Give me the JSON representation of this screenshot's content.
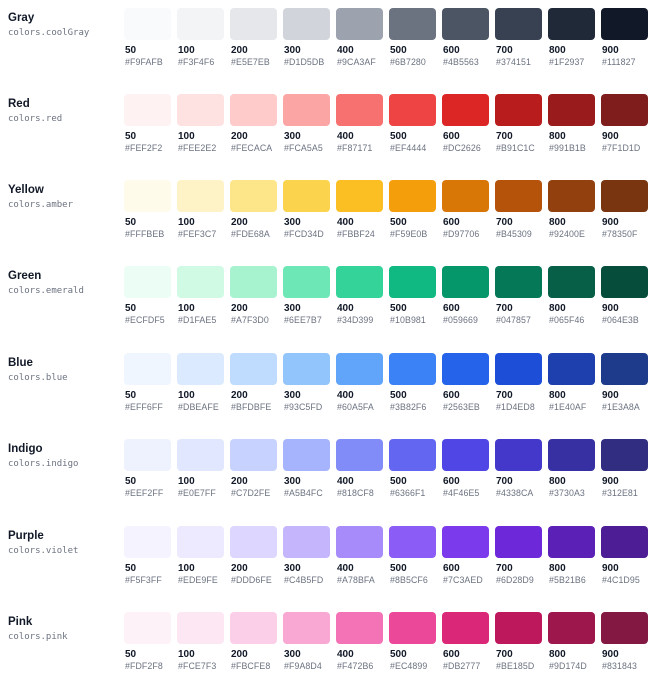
{
  "palettes": [
    {
      "name": "Gray",
      "key": "colors.coolGray",
      "shades": [
        {
          "shade": "50",
          "hex": "#F9FAFB"
        },
        {
          "shade": "100",
          "hex": "#F3F4F6"
        },
        {
          "shade": "200",
          "hex": "#E5E7EB"
        },
        {
          "shade": "300",
          "hex": "#D1D5DB"
        },
        {
          "shade": "400",
          "hex": "#9CA3AF"
        },
        {
          "shade": "500",
          "hex": "#6B7280"
        },
        {
          "shade": "600",
          "hex": "#4B5563"
        },
        {
          "shade": "700",
          "hex": "#374151"
        },
        {
          "shade": "800",
          "hex": "#1F2937"
        },
        {
          "shade": "900",
          "hex": "#111827"
        }
      ]
    },
    {
      "name": "Red",
      "key": "colors.red",
      "shades": [
        {
          "shade": "50",
          "hex": "#FEF2F2"
        },
        {
          "shade": "100",
          "hex": "#FEE2E2"
        },
        {
          "shade": "200",
          "hex": "#FECACA"
        },
        {
          "shade": "300",
          "hex": "#FCA5A5"
        },
        {
          "shade": "400",
          "hex": "#F87171"
        },
        {
          "shade": "500",
          "hex": "#EF4444"
        },
        {
          "shade": "600",
          "hex": "#DC2626"
        },
        {
          "shade": "700",
          "hex": "#B91C1C"
        },
        {
          "shade": "800",
          "hex": "#991B1B"
        },
        {
          "shade": "900",
          "hex": "#7F1D1D"
        }
      ]
    },
    {
      "name": "Yellow",
      "key": "colors.amber",
      "shades": [
        {
          "shade": "50",
          "hex": "#FFFBEB"
        },
        {
          "shade": "100",
          "hex": "#FEF3C7"
        },
        {
          "shade": "200",
          "hex": "#FDE68A"
        },
        {
          "shade": "300",
          "hex": "#FCD34D"
        },
        {
          "shade": "400",
          "hex": "#FBBF24"
        },
        {
          "shade": "500",
          "hex": "#F59E0B"
        },
        {
          "shade": "600",
          "hex": "#D97706"
        },
        {
          "shade": "700",
          "hex": "#B45309"
        },
        {
          "shade": "800",
          "hex": "#92400E"
        },
        {
          "shade": "900",
          "hex": "#78350F"
        }
      ]
    },
    {
      "name": "Green",
      "key": "colors.emerald",
      "shades": [
        {
          "shade": "50",
          "hex": "#ECFDF5"
        },
        {
          "shade": "100",
          "hex": "#D1FAE5"
        },
        {
          "shade": "200",
          "hex": "#A7F3D0"
        },
        {
          "shade": "300",
          "hex": "#6EE7B7"
        },
        {
          "shade": "400",
          "hex": "#34D399"
        },
        {
          "shade": "500",
          "hex": "#10B981"
        },
        {
          "shade": "600",
          "hex": "#059669"
        },
        {
          "shade": "700",
          "hex": "#047857"
        },
        {
          "shade": "800",
          "hex": "#065F46"
        },
        {
          "shade": "900",
          "hex": "#064E3B"
        }
      ]
    },
    {
      "name": "Blue",
      "key": "colors.blue",
      "shades": [
        {
          "shade": "50",
          "hex": "#EFF6FF"
        },
        {
          "shade": "100",
          "hex": "#DBEAFE"
        },
        {
          "shade": "200",
          "hex": "#BFDBFE"
        },
        {
          "shade": "300",
          "hex": "#93C5FD"
        },
        {
          "shade": "400",
          "hex": "#60A5FA"
        },
        {
          "shade": "500",
          "hex": "#3B82F6"
        },
        {
          "shade": "600",
          "hex": "#2563EB"
        },
        {
          "shade": "700",
          "hex": "#1D4ED8"
        },
        {
          "shade": "800",
          "hex": "#1E40AF"
        },
        {
          "shade": "900",
          "hex": "#1E3A8A"
        }
      ]
    },
    {
      "name": "Indigo",
      "key": "colors.indigo",
      "shades": [
        {
          "shade": "50",
          "hex": "#EEF2FF"
        },
        {
          "shade": "100",
          "hex": "#E0E7FF"
        },
        {
          "shade": "200",
          "hex": "#C7D2FE"
        },
        {
          "shade": "300",
          "hex": "#A5B4FC"
        },
        {
          "shade": "400",
          "hex": "#818CF8"
        },
        {
          "shade": "500",
          "hex": "#6366F1"
        },
        {
          "shade": "600",
          "hex": "#4F46E5"
        },
        {
          "shade": "700",
          "hex": "#4338CA"
        },
        {
          "shade": "800",
          "hex": "#3730A3"
        },
        {
          "shade": "900",
          "hex": "#312E81"
        }
      ]
    },
    {
      "name": "Purple",
      "key": "colors.violet",
      "shades": [
        {
          "shade": "50",
          "hex": "#F5F3FF"
        },
        {
          "shade": "100",
          "hex": "#EDE9FE"
        },
        {
          "shade": "200",
          "hex": "#DDD6FE"
        },
        {
          "shade": "300",
          "hex": "#C4B5FD"
        },
        {
          "shade": "400",
          "hex": "#A78BFA"
        },
        {
          "shade": "500",
          "hex": "#8B5CF6"
        },
        {
          "shade": "600",
          "hex": "#7C3AED"
        },
        {
          "shade": "700",
          "hex": "#6D28D9"
        },
        {
          "shade": "800",
          "hex": "#5B21B6"
        },
        {
          "shade": "900",
          "hex": "#4C1D95"
        }
      ]
    },
    {
      "name": "Pink",
      "key": "colors.pink",
      "shades": [
        {
          "shade": "50",
          "hex": "#FDF2F8"
        },
        {
          "shade": "100",
          "hex": "#FCE7F3"
        },
        {
          "shade": "200",
          "hex": "#FBCFE8"
        },
        {
          "shade": "300",
          "hex": "#F9A8D4"
        },
        {
          "shade": "400",
          "hex": "#F472B6"
        },
        {
          "shade": "500",
          "hex": "#EC4899"
        },
        {
          "shade": "600",
          "hex": "#DB2777"
        },
        {
          "shade": "700",
          "hex": "#BE185D"
        },
        {
          "shade": "800",
          "hex": "#9D174D"
        },
        {
          "shade": "900",
          "hex": "#831843"
        }
      ]
    }
  ]
}
